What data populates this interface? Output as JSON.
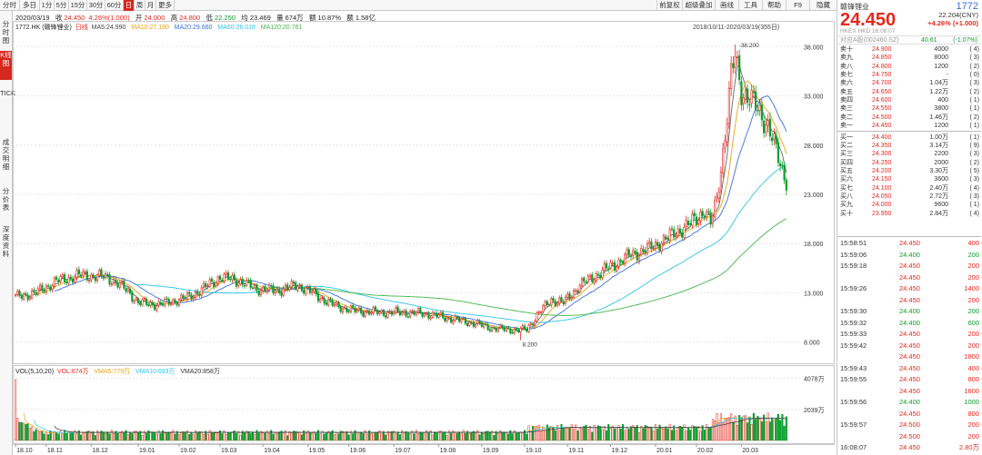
{
  "toolbar": {
    "tabs": [
      {
        "label": "分时",
        "active": false
      },
      {
        "label": "多日",
        "active": false
      },
      {
        "label": "1分",
        "active": false
      },
      {
        "label": "5分",
        "active": false
      },
      {
        "label": "15分",
        "active": false
      },
      {
        "label": "30分",
        "active": false
      },
      {
        "label": "60分",
        "active": false
      },
      {
        "label": "日",
        "active": true
      },
      {
        "label": "周",
        "active": false
      },
      {
        "label": "月",
        "active": false
      },
      {
        "label": "更多",
        "active": false
      }
    ],
    "right_buttons": [
      "前复权",
      "超级叠加",
      "画线",
      "工具",
      "帮助",
      "F9",
      "隐藏"
    ]
  },
  "left_tabs": [
    {
      "label": "分时图",
      "active": false
    },
    {
      "label": "K线图",
      "active": true
    },
    {
      "label": "TICK",
      "active": false
    },
    {
      "label": "成交明细",
      "active": false
    },
    {
      "label": "分价表",
      "active": false
    },
    {
      "label": "深度资料",
      "active": false
    }
  ],
  "info_bar": {
    "date": "2020/03/19",
    "close_label": "收",
    "close_value": "24.450",
    "change": "4.26%(1.000)",
    "open_label": "开",
    "open_value": "24.000",
    "high_label": "高",
    "high_value": "24.800",
    "low_label": "低",
    "low_value": "22.250",
    "avg_label": "均",
    "avg_value": "23.469",
    "volume_label": "量",
    "volume_value": "674万",
    "turnover_label": "额",
    "turnover_value": "10.87%",
    "amount_label": "额",
    "amount_value": "1.58亿"
  },
  "ma_legend": {
    "code": "1772.HK",
    "name": "(赣锋锂业)",
    "period": "日线",
    "ma5": "MA5:24.990",
    "ma10": "MA10:27.180",
    "ma20": "MA20:29.660",
    "ma60": "MA60:26.018",
    "ma120": "MA120:20.761",
    "range": "2018/10/11-2020/03/19(355日)"
  },
  "vol_legend": {
    "title": "VOL(5,10,20)",
    "vol": "VOL:674万",
    "vma5": "VMA5:779万",
    "vma10": "VMA10:693万",
    "vma20": "VMA20:858万"
  },
  "colors": {
    "up": "#e4281e",
    "down": "#0c9c2c",
    "ma5": "#666666",
    "ma10": "#e8a315",
    "ma20": "#3b6fd6",
    "ma60": "#2ec3e8",
    "ma120": "#43b649",
    "active_tab": "#d6281e"
  },
  "chart_data": {
    "type": "candlestick",
    "price_axis": [
      "38.000",
      "33.000",
      "28.000",
      "23.000",
      "18.000",
      "13.000",
      "8.000"
    ],
    "price_range": [
      6.5,
      39.5
    ],
    "volume_axis": [
      "4078万",
      "2039万"
    ],
    "volume_range": [
      0,
      4300
    ],
    "date_ticks": [
      "18.10",
      "18.11",
      "18.12",
      "19.01",
      "19.02",
      "19.03",
      "19.04",
      "19.05",
      "19.06",
      "19.07",
      "19.08",
      "19.09",
      "19.10",
      "19.11",
      "19.12",
      "20.01",
      "20.02",
      "20.03"
    ],
    "high_marker": "38.200",
    "low_marker": "8.200",
    "anchors": [
      [
        0,
        12.6
      ],
      [
        10,
        13.0
      ],
      [
        20,
        14.2
      ],
      [
        32,
        14.8
      ],
      [
        45,
        14.6
      ],
      [
        55,
        13.2
      ],
      [
        60,
        12.0
      ],
      [
        70,
        11.8
      ],
      [
        85,
        12.6
      ],
      [
        93,
        13.6
      ],
      [
        100,
        14.6
      ],
      [
        108,
        14.3
      ],
      [
        118,
        13.4
      ],
      [
        128,
        13.2
      ],
      [
        138,
        13.8
      ],
      [
        145,
        13.0
      ],
      [
        155,
        11.8
      ],
      [
        165,
        11.2
      ],
      [
        178,
        11.0
      ],
      [
        190,
        11.0
      ],
      [
        200,
        10.9
      ],
      [
        210,
        10.5
      ],
      [
        222,
        10.0
      ],
      [
        234,
        9.4
      ],
      [
        246,
        9.2
      ],
      [
        250,
        9.3
      ],
      [
        256,
        11.0
      ],
      [
        262,
        12.3
      ],
      [
        268,
        12.0
      ],
      [
        276,
        13.8
      ],
      [
        284,
        14.8
      ],
      [
        292,
        15.8
      ],
      [
        300,
        16.8
      ],
      [
        310,
        17.5
      ],
      [
        318,
        18.5
      ],
      [
        326,
        19.5
      ],
      [
        333,
        20.5
      ],
      [
        337,
        21.5
      ],
      [
        340,
        20.0
      ],
      [
        343,
        22.5
      ],
      [
        347,
        29.0
      ],
      [
        350,
        35.0
      ],
      [
        352,
        37.0
      ],
      [
        355,
        33.5
      ],
      [
        360,
        32.5
      ],
      [
        368,
        30.0
      ],
      [
        374,
        26.0
      ],
      [
        377,
        24.5
      ]
    ],
    "ma_series": [
      "MA5",
      "MA10",
      "MA20",
      "MA60",
      "MA120"
    ]
  },
  "order_book": {
    "stock_name": "赣锋锂业",
    "stock_code": "1772",
    "price": "24.450",
    "price_cny": "22.204(CNY)",
    "change": "+4.26%",
    "change_value": "(+1.000)",
    "market_line": "HKEX  HKD  16:08:07",
    "a_share_label": "对应A股(002460.SZ)",
    "a_share_price": "40.61",
    "a_share_change": "(-1.07%)",
    "asks": [
      {
        "label": "卖十",
        "price": "24.900",
        "volume": "4000",
        "count": "(    4)"
      },
      {
        "label": "卖九",
        "price": "24.850",
        "volume": "8000",
        "count": "(    3)"
      },
      {
        "label": "卖八",
        "price": "24.800",
        "volume": "1200",
        "count": "(    2)"
      },
      {
        "label": "卖七",
        "price": "24.750",
        "volume": "-",
        "count": "(    0)"
      },
      {
        "label": "卖六",
        "price": "24.700",
        "volume": "1.04万",
        "count": "(    3)"
      },
      {
        "label": "卖五",
        "price": "24.650",
        "volume": "1.22万",
        "count": "(    2)"
      },
      {
        "label": "卖四",
        "price": "24.600",
        "volume": "400",
        "count": "(    1)"
      },
      {
        "label": "卖三",
        "price": "24.550",
        "volume": "3800",
        "count": "(    1)"
      },
      {
        "label": "卖二",
        "price": "24.500",
        "volume": "1.46万",
        "count": "(    2)"
      },
      {
        "label": "卖一",
        "price": "24.450",
        "volume": "1200",
        "count": "(    1)"
      }
    ],
    "bids": [
      {
        "label": "买一",
        "price": "24.400",
        "volume": "1.00万",
        "count": "(    1)"
      },
      {
        "label": "买二",
        "price": "24.350",
        "volume": "3.14万",
        "count": "(    9)"
      },
      {
        "label": "买三",
        "price": "24.300",
        "volume": "2200",
        "count": "(    3)"
      },
      {
        "label": "买四",
        "price": "24.250",
        "volume": "2000",
        "count": "(    2)"
      },
      {
        "label": "买五",
        "price": "24.200",
        "volume": "3.30万",
        "count": "(    5)"
      },
      {
        "label": "买六",
        "price": "24.150",
        "volume": "3600",
        "count": "(    3)"
      },
      {
        "label": "买七",
        "price": "24.100",
        "volume": "2.40万",
        "count": "(    4)"
      },
      {
        "label": "买八",
        "price": "24.050",
        "volume": "2.72万",
        "count": "(    3)"
      },
      {
        "label": "买九",
        "price": "24.000",
        "volume": "9600",
        "count": "(    1)"
      },
      {
        "label": "买十",
        "price": "23.950",
        "volume": "2.84万",
        "count": "(    4)"
      }
    ]
  },
  "ticks": [
    {
      "time": "15:58:51",
      "price": "24.450",
      "volume": "400"
    },
    {
      "time": "15:59:06",
      "price": "24.400",
      "volume": "200"
    },
    {
      "time": "15:59:18",
      "price": "24.450",
      "volume": "200"
    },
    {
      "time": "",
      "price": "24.450",
      "volume": "200"
    },
    {
      "time": "15:59:26",
      "price": "24.450",
      "volume": "1400"
    },
    {
      "time": "",
      "price": "24.450",
      "volume": "200"
    },
    {
      "time": "15:59:30",
      "price": "24.400",
      "volume": "200"
    },
    {
      "time": "15:59:32",
      "price": "24.400",
      "volume": "600"
    },
    {
      "time": "15:59:33",
      "price": "24.450",
      "volume": "200"
    },
    {
      "time": "15:59:42",
      "price": "24.450",
      "volume": "200"
    },
    {
      "time": "",
      "price": "24.450",
      "volume": "1800"
    },
    {
      "time": "15:59:43",
      "price": "24.450",
      "volume": "400"
    },
    {
      "time": "15:59:55",
      "price": "24.450",
      "volume": "800"
    },
    {
      "time": "",
      "price": "24.450",
      "volume": "1600"
    },
    {
      "time": "15:59:56",
      "price": "24.400",
      "volume": "1000"
    },
    {
      "time": "",
      "price": "24.450",
      "volume": "800"
    },
    {
      "time": "15:59:57",
      "price": "24.500",
      "volume": "200"
    },
    {
      "time": "",
      "price": "24.500",
      "volume": "200"
    },
    {
      "time": "16:08:07",
      "price": "24.450",
      "volume": "2.80万"
    }
  ]
}
